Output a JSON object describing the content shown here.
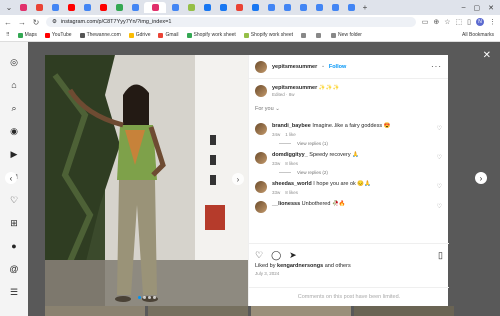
{
  "browser": {
    "tabs": [
      {
        "icon": "instagram",
        "color": "#e1306c"
      },
      {
        "icon": "gmail",
        "color": "#ea4335"
      },
      {
        "icon": "google",
        "color": "#4285f4"
      },
      {
        "icon": "youtube",
        "color": "#ff0000"
      },
      {
        "icon": "google",
        "color": "#4285f4"
      },
      {
        "icon": "youtube",
        "color": "#ff0000"
      },
      {
        "icon": "google",
        "color": "#34a853"
      },
      {
        "icon": "google",
        "color": "#4285f4"
      },
      {
        "icon": "instagram",
        "color": "#e1306c",
        "active": true
      },
      {
        "icon": "google",
        "color": "#4285f4"
      },
      {
        "icon": "shopify",
        "color": "#95bf47"
      },
      {
        "icon": "facebook",
        "color": "#1877f2"
      },
      {
        "icon": "facebook",
        "color": "#1877f2"
      },
      {
        "icon": "gmail",
        "color": "#ea4335"
      },
      {
        "icon": "facebook",
        "color": "#1877f2"
      },
      {
        "icon": "google",
        "color": "#4285f4"
      },
      {
        "icon": "google",
        "color": "#4285f4"
      },
      {
        "icon": "google",
        "color": "#4285f4"
      },
      {
        "icon": "google",
        "color": "#4285f4"
      },
      {
        "icon": "google",
        "color": "#4285f4"
      },
      {
        "icon": "google",
        "color": "#4285f4"
      }
    ],
    "url": "instagram.com/p/C8T7Yyy7Yn/?img_index=1",
    "profile_initial": "N",
    "bookmarks": [
      {
        "label": "Maps",
        "color": "#34a853"
      },
      {
        "label": "YouTube",
        "color": "#ff0000"
      },
      {
        "label": "Thewanne.com",
        "color": "#555555"
      },
      {
        "label": "Gdrive",
        "color": "#fbbc04"
      },
      {
        "label": "Gmail",
        "color": "#ea4335"
      },
      {
        "label": "Shopify work sheet",
        "color": "#34a853"
      },
      {
        "label": "Shopify work sheet",
        "color": "#95bf47"
      },
      {
        "label": "",
        "color": "#888888"
      },
      {
        "label": "",
        "color": "#888888"
      },
      {
        "label": "New folder",
        "color": "#888888"
      }
    ],
    "all_bookmarks": "All Bookmarks"
  },
  "post": {
    "username": "yepitsmesummer",
    "dot": "•",
    "follow": "Follow",
    "caption_emoji": "✨✨✨",
    "caption_meta": "Edited · 8w",
    "for_you": "For you",
    "comments": [
      {
        "user": "brandi_baybee",
        "text": "Imagine..like a fairy goddess 😍",
        "time": "34w",
        "likes": "1 like",
        "replies": "View replies (1)"
      },
      {
        "user": "domdiggityy_",
        "text": "Speedy recovery 🙏",
        "time": "33w",
        "likes": "8 likes",
        "replies": "View replies (2)"
      },
      {
        "user": "sheedas_world",
        "text": "I hope you are ok 😔🙏",
        "time": "33w",
        "likes": "8 likes",
        "replies": ""
      },
      {
        "user": "__lionesss",
        "text": "Unbothered 🥀🔥",
        "time": "",
        "likes": "",
        "replies": ""
      }
    ],
    "liked_by_prefix": "Liked by ",
    "liked_by_user": "kengardnersongs",
    "liked_by_suffix": " and others",
    "date": "July 3, 2024",
    "comments_off": "Comments on this post have been limited."
  }
}
